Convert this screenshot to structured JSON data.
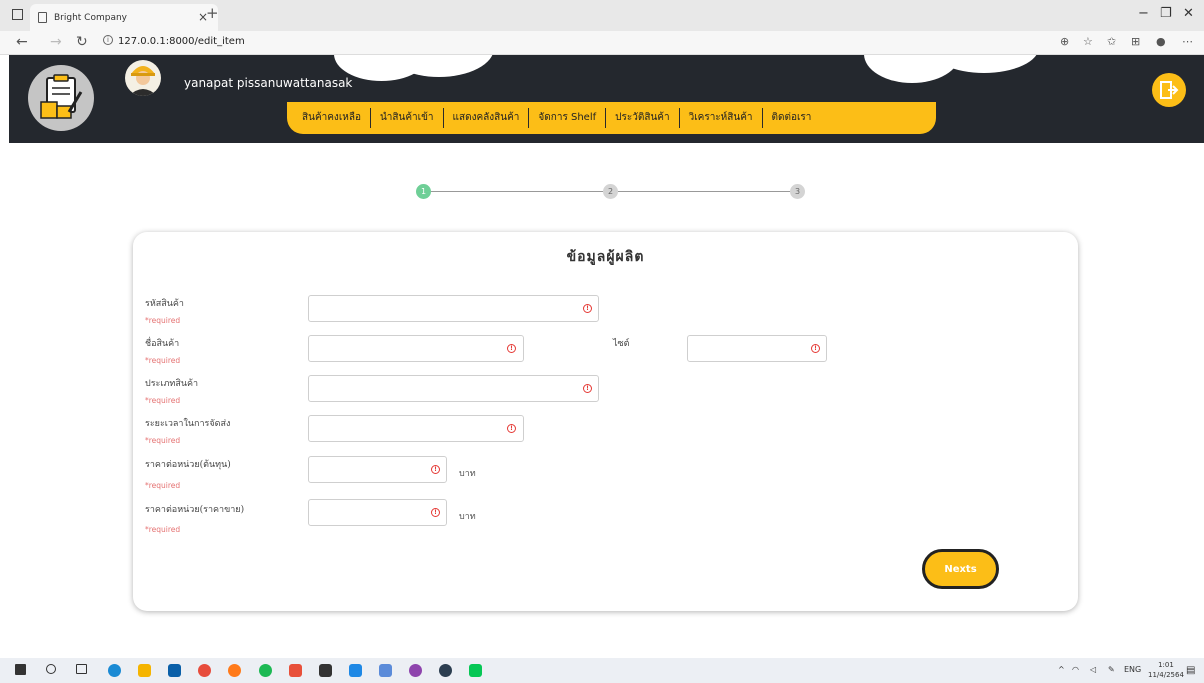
{
  "browser": {
    "tab_title": "Bright Company",
    "tab_close": "×",
    "new_tab": "+",
    "url": "127.0.0.1:8000/edit_item",
    "minimize": "−",
    "restore": "❐",
    "close": "✕"
  },
  "header": {
    "username": "yanapat pissanuwattanasak",
    "menu": [
      "สินค้าคงเหลือ",
      "นำสินค้าเข้า",
      "แสดงคลังสินค้า",
      "จัดการ Shelf",
      "ประวัติสินค้า",
      "วิเคราะห์สินค้า",
      "ติดต่อเรา"
    ]
  },
  "stepper": {
    "steps": [
      "1",
      "2",
      "3"
    ],
    "active": 1
  },
  "form": {
    "title": "ข้อมูลผู้ผลิต",
    "required_text": "*required",
    "fields": {
      "product_code": {
        "label": "รหัสสินค้า",
        "value": ""
      },
      "product_name": {
        "label": "ชื่อสินค้า",
        "value": ""
      },
      "size": {
        "label": "ไซต์",
        "value": ""
      },
      "product_type": {
        "label": "ประเภทสินค้า",
        "value": ""
      },
      "delivery_time": {
        "label": "ระยะเวลาในการจัดส่ง",
        "value": ""
      },
      "unit_cost": {
        "label": "ราคาต่อหน่วย(ต้นทุน)",
        "value": "",
        "unit": "บาท"
      },
      "unit_price": {
        "label": "ราคาต่อหน่วย(ราคาขาย)",
        "value": "",
        "unit": "บาท"
      }
    },
    "next_label": "Nexts"
  },
  "taskbar": {
    "language": "ENG",
    "time": "1:01",
    "date": "11/4/2564"
  },
  "colors": {
    "accent": "#fcbe17",
    "header_bg": "#24282e",
    "step_active": "#6fcf97",
    "error": "#e53935"
  }
}
